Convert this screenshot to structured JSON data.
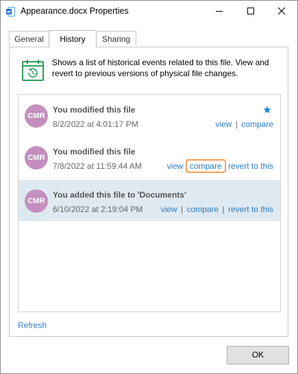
{
  "window": {
    "title": "Appearance.docx Properties",
    "app_icon": "word-document-icon"
  },
  "caption_buttons": [
    "minimize-icon",
    "maximize-icon",
    "close-icon"
  ],
  "tabs": [
    {
      "label": "General"
    },
    {
      "label": "History",
      "active": true
    },
    {
      "label": "Sharing"
    }
  ],
  "history": {
    "icon": "calendar-history-icon",
    "description": "Shows a list of historical events related to this file. View and revert to previous versions of physical file changes.",
    "entries": [
      {
        "avatar": "CMR",
        "title": "You modified this file",
        "date": "8/2/2022 at 4:01:17 PM",
        "starred": true,
        "actions": {
          "view": "view",
          "compare": "compare"
        },
        "separator": "|"
      },
      {
        "avatar": "CMR",
        "title": "You modified this file",
        "date": "7/8/2022 at 11:59:44 AM",
        "actions": {
          "view": "view",
          "compare": "compare",
          "revert": "revert to this"
        },
        "focused_action": "compare"
      },
      {
        "avatar": "CMR",
        "title": "You added this file to 'Documents'",
        "date": "6/10/2022 at 2:19:04 PM",
        "selected": true,
        "actions": {
          "view": "view",
          "compare": "compare",
          "revert": "revert to this"
        },
        "separator": "|"
      }
    ],
    "refresh_label": "Refresh"
  },
  "buttons": {
    "ok_label": "OK"
  },
  "colors": {
    "link": "#2b7cc8",
    "avatar": "#c48fbf",
    "selected_row": "#dfe9f2",
    "focus_ring": "#f2a057",
    "star": "#1e88e5",
    "icon_green": "#2e9e5b"
  }
}
